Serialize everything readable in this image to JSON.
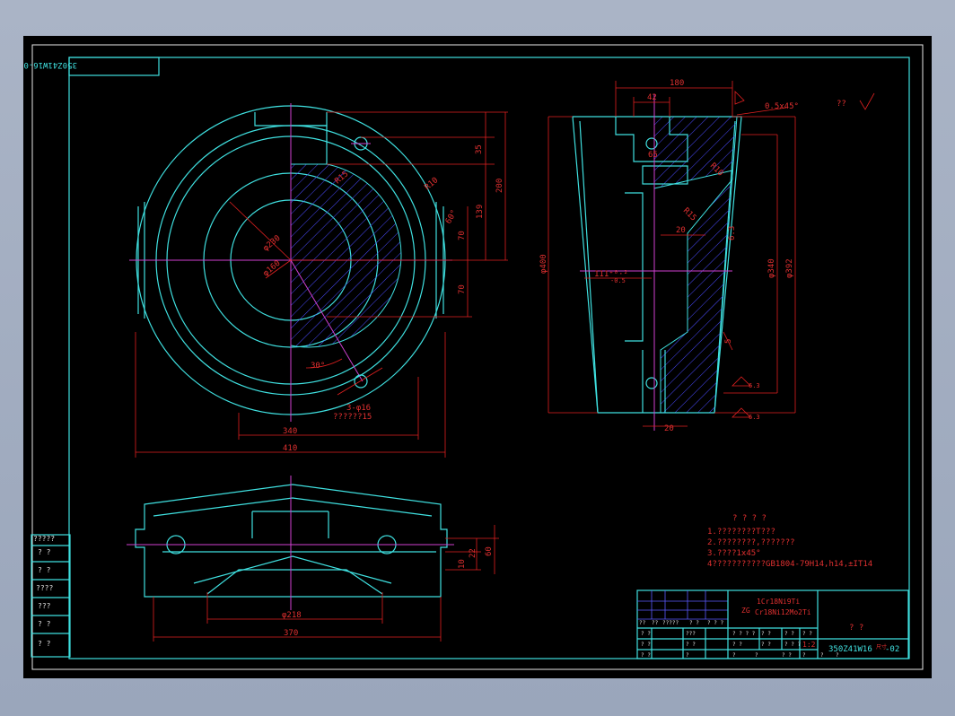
{
  "drawing_no": "350Z41W16",
  "drawing_no_suffix": "-02",
  "drawing_no_superscript": "尺寸",
  "top_label_rotated": "350Z41W16-02",
  "corner_symbol": "??",
  "dimensions": {
    "d35": "35",
    "d200": "200",
    "d139": "139",
    "d70a": "70",
    "d70b": "70",
    "r15a": "R15",
    "r10": "R10",
    "phi230": "φ230",
    "phi160": "φ160",
    "ang30": "30°",
    "ang60": "60°",
    "holes": "3-φ16",
    "holes_note": "??????15",
    "w340": "340",
    "w410": "410",
    "t180": "180",
    "t42": "42",
    "t65": "65",
    "ch": "0.5x45°",
    "r10b": "R10",
    "r15b": "R15",
    "d20": "20",
    "phi400": "φ400",
    "phi340": "φ340",
    "phi392": "φ392",
    "fit": "111⁺⁰·²",
    "fit2": "-0.5",
    "d5": "5",
    "d20b": "20",
    "s1": "6.3",
    "s2": "6.3",
    "s3": "6.3",
    "phi218": "φ218",
    "w370": "370",
    "v10": "10",
    "v22": "22",
    "v60": "60"
  },
  "notes": {
    "title": "? ? ? ?",
    "n1": "1.????????T???",
    "n2": "2.????????,???????",
    "n3": "3.????1x45°",
    "n4": "4???????????GB1804-79H14,h14,±IT14"
  },
  "title_block": {
    "material1": "1Cr18Ni9Ti",
    "material_prefix": "ZG",
    "material2": "Cr18Ni12Mo2Ti",
    "name": "?   ?",
    "scale": "1:2",
    "cells": [
      "??",
      "??",
      "?????",
      "? ?",
      "? ? ?",
      "? ?",
      "???",
      "? ?",
      "? ?",
      "? ?",
      "? ? ? ?",
      "? ?",
      "? ?",
      "? ?",
      "?",
      "?",
      "?",
      "? ?",
      "? ?",
      "? ?",
      "? ? ?",
      "?",
      "?",
      "?"
    ]
  },
  "side_block": [
    "?????",
    "? ?",
    "? ?",
    "????",
    "???",
    "? ?",
    "? ?"
  ]
}
